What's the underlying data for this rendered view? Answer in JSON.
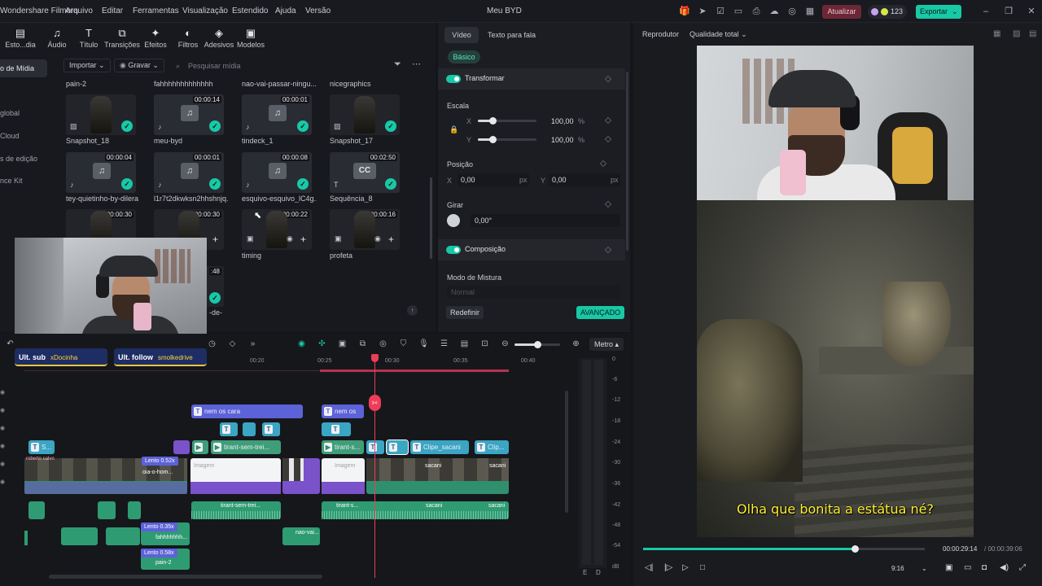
{
  "menubar": {
    "app_name": "Wondershare Filmora",
    "items": [
      "Arquivo",
      "Editar",
      "Ferramentas",
      "Visualização",
      "Estendido",
      "Ajuda",
      "Versão"
    ],
    "project_title": "Meu BYD",
    "upgrade_label": "Atualizar",
    "credits": "123",
    "export_label": "Exportar",
    "colors": {
      "accent": "#17c9a6",
      "upgrade": "#6b2735"
    }
  },
  "media": {
    "tools": [
      "Esto...dia",
      "Áudio",
      "Título",
      "Transições",
      "Efeitos",
      "Filtros",
      "Adesivos",
      "Modelos"
    ],
    "sidebar": [
      "o de Mídia",
      "global",
      "Cloud",
      "s de edição",
      "nce Kit"
    ],
    "import_label": "Importar",
    "record_label": "Gravar",
    "search_placeholder": "Pesquisar mídia",
    "top_names": [
      "pain-2",
      "fahhhhhhhhhhhhh",
      "nao-vai-passar-ningu...",
      "nicegraphics"
    ],
    "items": [
      {
        "name": "Snapshot_18",
        "duration": ""
      },
      {
        "name": "meu-byd",
        "duration": "00:00:14"
      },
      {
        "name": "tindeck_1",
        "duration": "00:00:01"
      },
      {
        "name": "Snapshot_17",
        "duration": ""
      },
      {
        "name": "tey-quietinho-by-dilera",
        "duration": "00:00:04"
      },
      {
        "name": "l1r7t2dkwksn2hhshnjq...",
        "duration": "00:00:01"
      },
      {
        "name": "esquivo-esquivo_lC4g...",
        "duration": "00:00:08"
      },
      {
        "name": "Sequência_8",
        "duration": "00:02:50"
      },
      {
        "name": "",
        "duration": "00:00:30"
      },
      {
        "name": "",
        "duration": "00:00:30"
      },
      {
        "name": "timing",
        "duration": "00:00:22"
      },
      {
        "name": "profeta",
        "duration": "00:00:16"
      }
    ],
    "hidden_tail": [
      ":48",
      "-de-"
    ],
    "cc_label": "CC"
  },
  "props": {
    "tabs": [
      "Vídeo",
      "Texto para fala"
    ],
    "basic": "Básico",
    "transform": "Transformar",
    "scale_label": "Escala",
    "scale_x": "100,00",
    "scale_y": "100,00",
    "percent": "%",
    "position_label": "Posição",
    "pos_x": "0,00",
    "pos_y": "0,00",
    "px": "px",
    "rotate_label": "Girar",
    "rotate_value": "0,00°",
    "composition": "Composição",
    "blend_label": "Modo de Mistura",
    "blend_value": "Normal",
    "reset_label": "Redefinir",
    "advanced_label": "AVANÇADO",
    "axis_x": "X",
    "axis_y": "Y"
  },
  "player": {
    "title": "Reprodutor",
    "quality": "Qualidade total",
    "subtitle": "Olha que bonita a estátua né?",
    "current_time": "00:00:29:14",
    "total_time": "/ 00:00:39:06",
    "progress": 0.75,
    "aspect": "9:16"
  },
  "timeline": {
    "meter_label": "Metro",
    "ruler": [
      "00:20",
      "00:25",
      "00:30",
      "00:35",
      "00:40"
    ],
    "db_marks": [
      "0",
      "-6",
      "-12",
      "-18",
      "-24",
      "-30",
      "-36",
      "-42",
      "-48",
      "-54",
      "dB"
    ],
    "lr": [
      "E",
      "D"
    ],
    "clips": {
      "text1": "nem os cara",
      "text2": "nem os",
      "tirant1": "tirant-sem-trei...",
      "tirant2": "tirant-s...",
      "sacani1": "Clipe_sacani",
      "sacani2": "Clip...",
      "s": "S...",
      "vid_a": "sacani",
      "vid_b": "sacani",
      "oia": "oia-o-hom...",
      "imagem1": "Imagem",
      "imagem2": "Imagem",
      "aud_tirant": "tirant-sem-trei...",
      "aud_tirant2": "tirant-s...",
      "aud_sacani": "sacani",
      "aud_sacani2": "sacani",
      "aud_fah": "fahhhhhhh...",
      "aud_pain": "pain-2",
      "aud_nao": "nao-vai...",
      "slow1": "Lento 0.52x",
      "slow2": "Lento 0.35x",
      "slow3": "Lento 0.58x",
      "mini": "roberto salvo"
    }
  },
  "overlays": {
    "sub_label": "Ult. sub",
    "sub_user": "xDocinha",
    "follow_label": "Ult. follow",
    "follow_user": "smolkedrive"
  }
}
